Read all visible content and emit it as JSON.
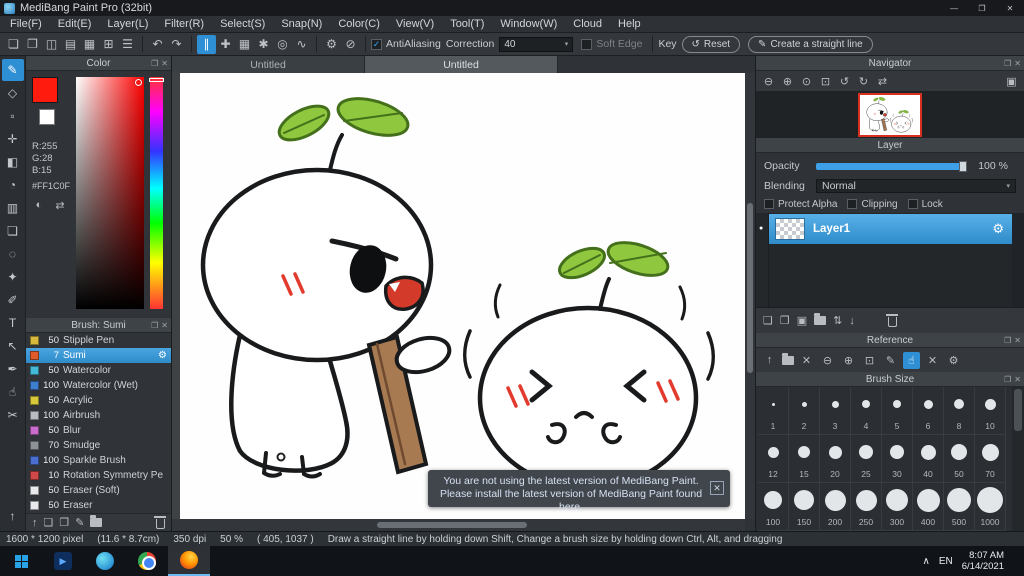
{
  "title_bar": {
    "title": "MediBang Paint Pro (32bit)"
  },
  "menu_bar": [
    "File(F)",
    "Edit(E)",
    "Layer(L)",
    "Filter(R)",
    "Select(S)",
    "Snap(N)",
    "Color(C)",
    "View(V)",
    "Tool(T)",
    "Window(W)",
    "Cloud",
    "Help"
  ],
  "toolbar": {
    "antialiasing": "AntiAliasing",
    "correction": "Correction",
    "correction_value": "40",
    "soft_edge": "Soft Edge",
    "key": "Key",
    "reset": "Reset",
    "create_line": "Create a straight line"
  },
  "tabs": [
    "Untitled",
    "Untitled"
  ],
  "color_panel": {
    "title": "Color",
    "r": "R:255",
    "g": "G:28",
    "b": "B:15",
    "hex": "#FF1C0F",
    "swatch_style": "background:#ff1c0f"
  },
  "brush_panel": {
    "title": "Brush: Sumi",
    "items": [
      {
        "size": "50",
        "name": "Stipple Pen",
        "chip": "#d8b93c",
        "selected": false
      },
      {
        "size": "7",
        "name": "Sumi",
        "chip": "#e05a2b",
        "selected": true
      },
      {
        "size": "50",
        "name": "Watercolor",
        "chip": "#45b8d8",
        "selected": false
      },
      {
        "size": "100",
        "name": "Watercolor (Wet)",
        "chip": "#3f7fd0",
        "selected": false
      },
      {
        "size": "50",
        "name": "Acrylic",
        "chip": "#d8c83c",
        "selected": false
      },
      {
        "size": "100",
        "name": "Airbrush",
        "chip": "#b9bdc1",
        "selected": false
      },
      {
        "size": "50",
        "name": "Blur",
        "chip": "#c96ccd",
        "selected": false
      },
      {
        "size": "70",
        "name": "Smudge",
        "chip": "#8d9297",
        "selected": false
      },
      {
        "size": "100",
        "name": "Sparkle Brush",
        "chip": "#4a6fd0",
        "selected": false
      },
      {
        "size": "10",
        "name": "Rotation Symmetry Pe",
        "chip": "#d04848",
        "selected": false
      },
      {
        "size": "50",
        "name": "Eraser (Soft)",
        "chip": "#e8eaec",
        "selected": false
      },
      {
        "size": "50",
        "name": "Eraser",
        "chip": "#e8eaec",
        "selected": false
      }
    ]
  },
  "navigator": {
    "title": "Navigator"
  },
  "layer_panel": {
    "title": "Layer",
    "opacity_label": "Opacity",
    "opacity_value": "100 %",
    "blending_label": "Blending",
    "blending_value": "Normal",
    "protect_alpha": "Protect Alpha",
    "clipping": "Clipping",
    "lock": "Lock",
    "layers": [
      {
        "name": "Layer1",
        "selected": true
      }
    ]
  },
  "reference_panel": {
    "title": "Reference"
  },
  "brush_size_panel": {
    "title": "Brush Size",
    "sizes": [
      1,
      2,
      3,
      4,
      5,
      6,
      8,
      10,
      12,
      15,
      20,
      25,
      30,
      40,
      50,
      70,
      100,
      150,
      200,
      250,
      300,
      400,
      500,
      1000
    ]
  },
  "notification": {
    "line1": "You are not using the latest version of MediBang Paint.",
    "line2": "Please install the latest version of MediBang Paint found here."
  },
  "status_bar": {
    "size": "1600 * 1200 pixel",
    "cm": "(11.6 * 8.7cm)",
    "dpi": "350 dpi",
    "zoom": "50 %",
    "coords": "( 405, 1037 )",
    "hint": "Draw a straight line by holding down Shift, Change a brush size by holding down Ctrl, Alt, and dragging"
  },
  "taskbar": {
    "lang": "EN",
    "time": "8:07 AM",
    "date": "6/14/2021"
  },
  "icons": {
    "minimize": "—",
    "maximize": "❐",
    "close": "✕",
    "new_canvas": "❏",
    "open_file": "❐",
    "save": "◫",
    "export": "▤",
    "view_grid": "▦",
    "materials": "⊞",
    "panel_layout": "☰",
    "undo": "↶",
    "redo": "↷",
    "snap_parallel": "∥",
    "snap_cross": "✚",
    "snap_grid": "▦",
    "snap_vanish": "✱",
    "snap_concentric": "◎",
    "snap_curve": "∿",
    "snap_settings": "⚙",
    "snap_off": "⊘",
    "check": "✓",
    "arrow_down": "▾",
    "reset_arrow": "↺",
    "pen": "✎",
    "zoom_out": "⊖",
    "zoom_in": "⊕",
    "zoom_actual": "⊙",
    "zoom_fit": "⊡",
    "rotate_left": "↺",
    "rotate_right": "↻",
    "flip": "⇄",
    "thumb_view": "▣",
    "gear": "⚙",
    "eye": "●",
    "new_layer": "❏",
    "dup_layer": "❐",
    "camera": "▣",
    "transfer": "⇅",
    "merge_down": "↓",
    "arrow_up": "↑",
    "hand": "☝",
    "clear": "✕",
    "tool_brush": "✎",
    "tool_eraser": "◇",
    "tool_dot": "▫",
    "tool_move": "✛",
    "tool_fill": "◧",
    "tool_bucket": "◔",
    "tool_gradient": "▥",
    "tool_select": "❏",
    "tool_lasso": "◌",
    "tool_wand": "✦",
    "tool_selpen": "✐",
    "tool_text": "T",
    "tool_operation": "↖",
    "tool_picker": "✒",
    "tool_hand": "☝",
    "tool_slice": "✂",
    "dock": "↑",
    "swap": "⇄",
    "wheel": "◐",
    "tray_up": "∧",
    "play": "▶"
  }
}
